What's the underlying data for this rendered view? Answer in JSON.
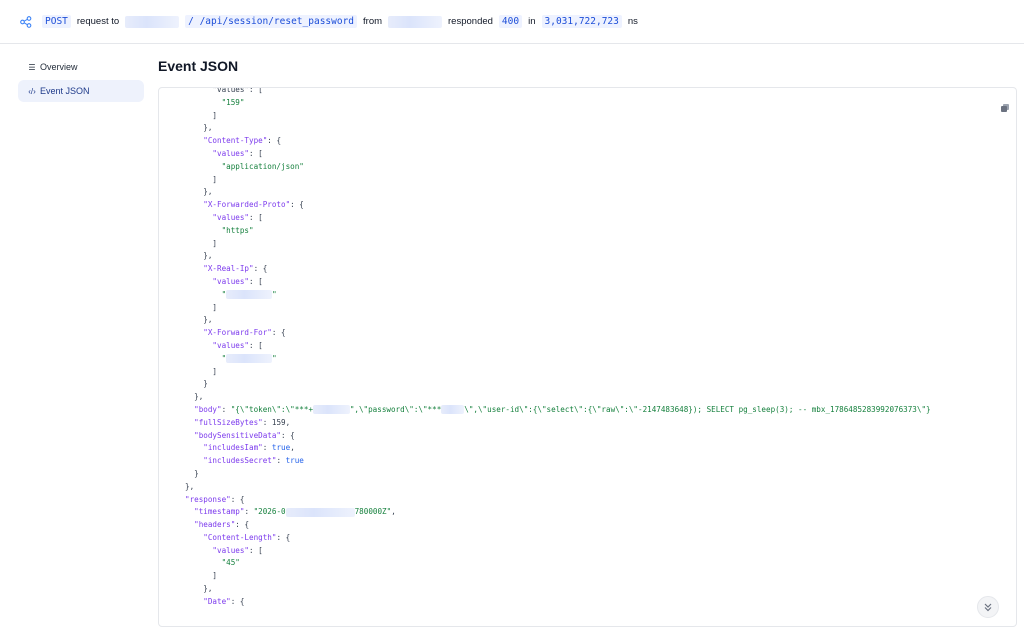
{
  "header": {
    "method": "POST",
    "request_to_text": "request to",
    "path": "/ /api/session/reset_password",
    "from_text": "from",
    "responded_text": "responded",
    "status": "400",
    "in_text": "in",
    "duration": "3,031,722,723",
    "unit": "ns"
  },
  "sidebar": {
    "items": [
      {
        "label": "Overview",
        "icon": "list-icon"
      },
      {
        "label": "Event JSON",
        "icon": "code-icon"
      }
    ]
  },
  "main": {
    "title": "Event JSON"
  },
  "code": {
    "lines": [
      [
        [
          "p",
          "      \"values\": ["
        ]
      ],
      [
        [
          "s",
          "        \"159\""
        ]
      ],
      [
        [
          "p",
          "      ]"
        ]
      ],
      [
        [
          "p",
          "    },"
        ]
      ],
      [
        [
          "k",
          "    \"Content-Type\""
        ],
        [
          "p",
          ": {"
        ]
      ],
      [
        [
          "k",
          "      \"values\""
        ],
        [
          "p",
          ": ["
        ]
      ],
      [
        [
          "s",
          "        \"application/json\""
        ]
      ],
      [
        [
          "p",
          "      ]"
        ]
      ],
      [
        [
          "p",
          "    },"
        ]
      ],
      [
        [
          "k",
          "    \"X-Forwarded-Proto\""
        ],
        [
          "p",
          ": {"
        ]
      ],
      [
        [
          "k",
          "      \"values\""
        ],
        [
          "p",
          ": ["
        ]
      ],
      [
        [
          "s",
          "        \"https\""
        ]
      ],
      [
        [
          "p",
          "      ]"
        ]
      ],
      [
        [
          "p",
          "    },"
        ]
      ],
      [
        [
          "k",
          "    \"X-Real-Ip\""
        ],
        [
          "p",
          ": {"
        ]
      ],
      [
        [
          "k",
          "      \"values\""
        ],
        [
          "p",
          ": ["
        ]
      ],
      [
        [
          "s",
          "        \""
        ],
        [
          "r",
          "          "
        ],
        [
          "s",
          "\""
        ]
      ],
      [
        [
          "p",
          "      ]"
        ]
      ],
      [
        [
          "p",
          "    },"
        ]
      ],
      [
        [
          "k",
          "    \"X-Forward-For\""
        ],
        [
          "p",
          ": {"
        ]
      ],
      [
        [
          "k",
          "      \"values\""
        ],
        [
          "p",
          ": ["
        ]
      ],
      [
        [
          "s",
          "        \""
        ],
        [
          "r",
          "          "
        ],
        [
          "s",
          "\""
        ]
      ],
      [
        [
          "p",
          "      ]"
        ]
      ],
      [
        [
          "p",
          "    }"
        ]
      ],
      [
        [
          "p",
          "  },"
        ]
      ],
      [
        [
          "k",
          "  \"body\""
        ],
        [
          "p",
          ": "
        ],
        [
          "s",
          "\"{\\\"token\\\":\\\"***+"
        ],
        [
          "r",
          "        "
        ],
        [
          "s",
          "\",\\\"password\\\":\\\"***"
        ],
        [
          "r",
          "     "
        ],
        [
          "s",
          "\\\",\\\"user-id\\\":{\\\"select\\\":{\\\"raw\\\":\\\"-2147483648}); SELECT pg_sleep(3); -- mbx_1786485283992076373\\\"}"
        ]
      ],
      [
        [
          "k",
          "  \"fullSizeBytes\""
        ],
        [
          "p",
          ": "
        ],
        [
          "n",
          "159"
        ],
        [
          "p",
          ","
        ]
      ],
      [
        [
          "k",
          "  \"bodySensitiveData\""
        ],
        [
          "p",
          ": {"
        ]
      ],
      [
        [
          "k",
          "    \"includesIam\""
        ],
        [
          "p",
          ": "
        ],
        [
          "b",
          "true"
        ],
        [
          "p",
          ","
        ]
      ],
      [
        [
          "k",
          "    \"includesSecret\""
        ],
        [
          "p",
          ": "
        ],
        [
          "b",
          "true"
        ]
      ],
      [
        [
          "p",
          "  }"
        ]
      ],
      [
        [
          "p",
          "},"
        ]
      ],
      [
        [
          "k",
          "\"response\""
        ],
        [
          "p",
          ": {"
        ]
      ],
      [
        [
          "k",
          "  \"timestamp\""
        ],
        [
          "p",
          ": "
        ],
        [
          "s",
          "\"2026-0"
        ],
        [
          "r",
          "               "
        ],
        [
          "s",
          "780000Z\""
        ],
        [
          "p",
          ","
        ]
      ],
      [
        [
          "k",
          "  \"headers\""
        ],
        [
          "p",
          ": {"
        ]
      ],
      [
        [
          "k",
          "    \"Content-Length\""
        ],
        [
          "p",
          ": {"
        ]
      ],
      [
        [
          "k",
          "      \"values\""
        ],
        [
          "p",
          ": ["
        ]
      ],
      [
        [
          "s",
          "        \"45\""
        ]
      ],
      [
        [
          "p",
          "      ]"
        ]
      ],
      [
        [
          "p",
          "    },"
        ]
      ],
      [
        [
          "k",
          "    \"Date\""
        ],
        [
          "p",
          ": {"
        ]
      ]
    ]
  }
}
